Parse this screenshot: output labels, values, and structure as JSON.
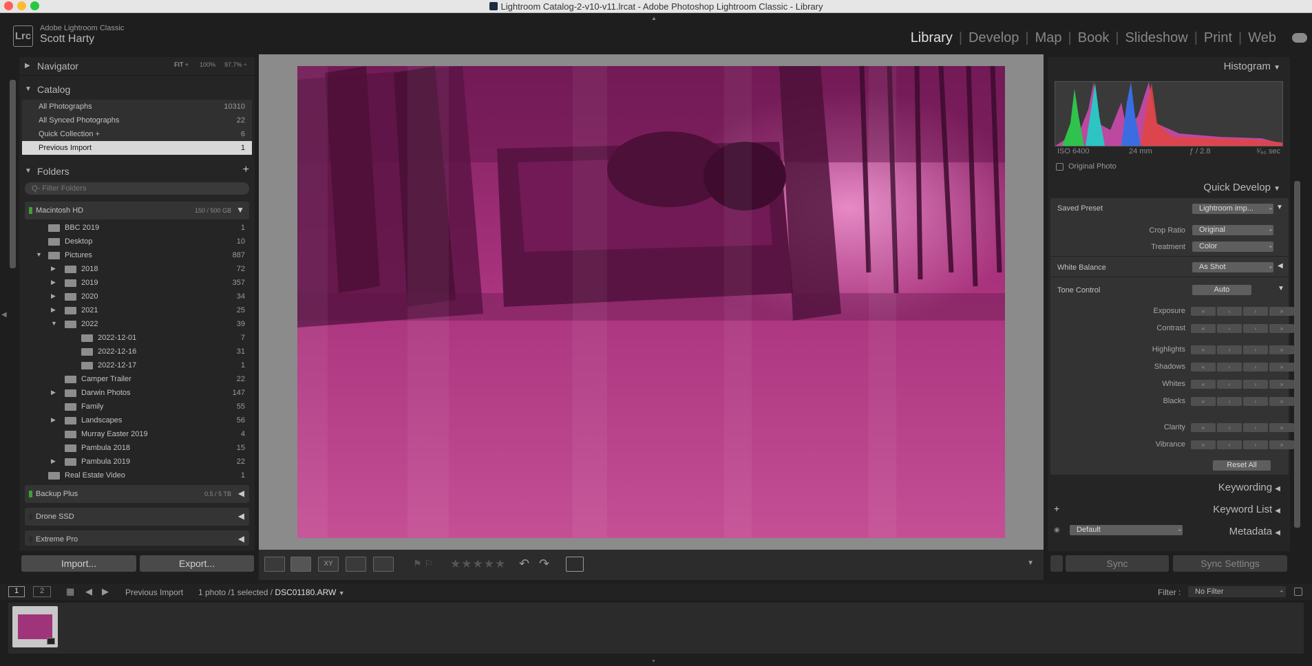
{
  "window": {
    "title": "Lightroom Catalog-2-v10-v11.lrcat - Adobe Photoshop Lightroom Classic - Library"
  },
  "identity": {
    "badge": "Lrc",
    "app_name": "Adobe Lightroom Classic",
    "user": "Scott Harty"
  },
  "modules": [
    "Library",
    "Develop",
    "Map",
    "Book",
    "Slideshow",
    "Print",
    "Web"
  ],
  "navigator": {
    "title": "Navigator",
    "zoom_fit": "FIT ÷",
    "zoom_100": "100%",
    "zoom_custom": "97.7% ÷"
  },
  "catalog": {
    "title": "Catalog",
    "items": [
      {
        "label": "All Photographs",
        "count": "10310"
      },
      {
        "label": "All Synced Photographs",
        "count": "22"
      },
      {
        "label": "Quick Collection  +",
        "count": "6"
      },
      {
        "label": "Previous Import",
        "count": "1"
      }
    ]
  },
  "folders": {
    "title": "Folders",
    "add": "+",
    "filter_placeholder": "Q- Filter Folders",
    "volume": {
      "name": "Macintosh HD",
      "capacity": "150 / 500 GB"
    },
    "items": [
      {
        "label": "BBC 2019",
        "count": "1"
      },
      {
        "label": "Desktop",
        "count": "10"
      },
      {
        "label": "Pictures",
        "count": "887"
      },
      {
        "label": "2018",
        "count": "72"
      },
      {
        "label": "2019",
        "count": "357"
      },
      {
        "label": "2020",
        "count": "34"
      },
      {
        "label": "2021",
        "count": "25"
      },
      {
        "label": "2022",
        "count": "39"
      },
      {
        "label": "2022-12-01",
        "count": "7"
      },
      {
        "label": "2022-12-16",
        "count": "31"
      },
      {
        "label": "2022-12-17",
        "count": "1"
      },
      {
        "label": "Camper Trailer",
        "count": "22"
      },
      {
        "label": "Darwin Photos",
        "count": "147"
      },
      {
        "label": "Family",
        "count": "55"
      },
      {
        "label": "Landscapes",
        "count": "56"
      },
      {
        "label": "Murray Easter 2019",
        "count": "4"
      },
      {
        "label": "Pambula 2018",
        "count": "15"
      },
      {
        "label": "Pambula 2019",
        "count": "22"
      },
      {
        "label": "Real Estate Video",
        "count": "1"
      }
    ],
    "volumes_other": [
      {
        "name": "Backup Plus",
        "capacity": "0.5 / 5 TB"
      },
      {
        "name": "Drone SSD",
        "capacity": ""
      },
      {
        "name": "Extreme Pro",
        "capacity": ""
      }
    ]
  },
  "buttons": {
    "import": "Import...",
    "export": "Export...",
    "sync": "Sync",
    "sync_settings": "Sync Settings",
    "reset_all": "Reset All",
    "auto": "Auto"
  },
  "histogram": {
    "title": "Histogram",
    "iso": "ISO 6400",
    "focal": "24 mm",
    "aperture": "ƒ / 2.8",
    "shutter": "¹⁄₆₀ sec",
    "original_photo": "Original Photo"
  },
  "quick_develop": {
    "title": "Quick Develop",
    "saved_preset_label": "Saved Preset",
    "saved_preset_value": "Lightroom imp...",
    "crop_ratio_label": "Crop Ratio",
    "crop_ratio_value": "Original",
    "treatment_label": "Treatment",
    "treatment_value": "Color",
    "white_balance_label": "White Balance",
    "white_balance_value": "As Shot",
    "tone_control_label": "Tone Control",
    "sliders": [
      "Exposure",
      "Contrast",
      "Highlights",
      "Shadows",
      "Whites",
      "Blacks",
      "Clarity",
      "Vibrance"
    ]
  },
  "right_panels": {
    "keywording": "Keywording",
    "keyword_list": "Keyword List",
    "keyword_add": "+",
    "metadata": "Metadata",
    "metadata_preset": "Default"
  },
  "filmstrip_bar": {
    "page1": "1",
    "page2": "2",
    "source": "Previous Import",
    "count_text": "1 photo /1 selected /",
    "filename": "DSC01180.ARW",
    "filter_label": "Filter :",
    "filter_value": "No Filter"
  },
  "stars": "★★★★★",
  "colors": {
    "accent_magenta": "#c0408f",
    "selected_row": "#d8d8d8",
    "volume_led": "#3e9f36"
  }
}
